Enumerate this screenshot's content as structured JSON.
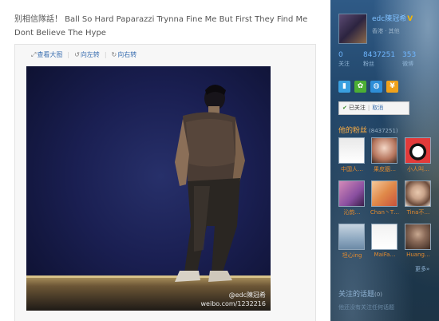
{
  "post": {
    "text": "别相信隊話！ Ball So Hard Paparazzi Trynna Fine Me But First They Find Me Dont Believe The Hype"
  },
  "media": {
    "view_large": "查看大图",
    "rotate_left": "向左转",
    "rotate_right": "向右转",
    "watermark_handle": "@edc陳冠希",
    "watermark_url": "weibo.com/1232216"
  },
  "profile": {
    "name": "edc陳冠希",
    "city": "香港 · 其他",
    "stats": [
      {
        "value": "0",
        "label": "关注"
      },
      {
        "value": "8437251",
        "label": "粉丝"
      },
      {
        "value": "353",
        "label": "微博"
      }
    ],
    "apps": [
      {
        "icon": "mobile-icon",
        "color": "#3aa0e0"
      },
      {
        "icon": "game-icon",
        "color": "#4cae34"
      },
      {
        "icon": "qq-icon",
        "color": "#2e8ed8"
      },
      {
        "icon": "money-icon",
        "color": "#f0a21b"
      }
    ],
    "follow_status": "已关注",
    "unfollow": "取消"
  },
  "fans": {
    "header": "他的粉丝",
    "count": "(8437251)",
    "items": [
      {
        "name": "中国人…",
        "colors": [
          "#e9e9e9",
          "#ffffff"
        ]
      },
      {
        "name": "果皮胭…",
        "colors": [
          "#f4d7c6",
          "#b5745c"
        ]
      },
      {
        "name": "小人叫…",
        "colors": [
          "#e23a3a",
          "#1a1a1a"
        ]
      },
      {
        "name": "沁韵…",
        "colors": [
          "#8a4fa0",
          "#d48ab8"
        ]
      },
      {
        "name": "Chan丶T…",
        "colors": [
          "#f5c99a",
          "#c9523a"
        ]
      },
      {
        "name": "Tina不…",
        "colors": [
          "#c9a38a",
          "#6a4a3a"
        ]
      },
      {
        "name": "坦心ing",
        "colors": [
          "#c6d4e0",
          "#6c8aa6"
        ]
      },
      {
        "name": "MaiFa…",
        "colors": [
          "#efefef",
          "#ffffff"
        ]
      },
      {
        "name": "Huang…",
        "colors": [
          "#c8a890",
          "#3b2a22"
        ]
      }
    ],
    "more": "更多»"
  },
  "topics": {
    "header": "关注的话题",
    "count": "(0)",
    "empty_text": "他还没有关注任何话题"
  }
}
